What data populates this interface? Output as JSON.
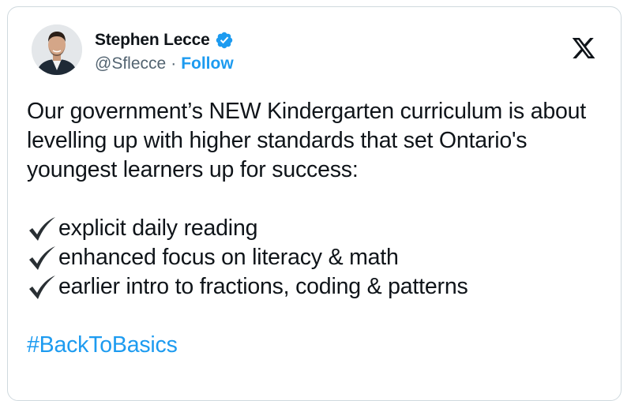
{
  "tweet": {
    "author": {
      "display_name": "Stephen Lecce",
      "handle": "@Sflecce",
      "separator": "·",
      "follow_label": "Follow",
      "verified": true,
      "verified_color": "#1d9bf0"
    },
    "text_intro": "Our government’s NEW Kindergarten curriculum is about levelling up with higher standards that set Ontario's youngest learners up for success:",
    "checklist": [
      {
        "icon": "check-mark-icon",
        "label": "explicit daily reading"
      },
      {
        "icon": "check-mark-icon",
        "label": "enhanced focus on literacy & math"
      },
      {
        "icon": "check-mark-icon",
        "label": "earlier intro to fractions, coding & patterns"
      }
    ],
    "hashtag": "#BackToBasics"
  },
  "platform_icon": "x-logo-icon",
  "colors": {
    "text": "#0f1419",
    "secondary": "#536471",
    "link": "#1d9bf0",
    "border": "#cfd9de"
  }
}
